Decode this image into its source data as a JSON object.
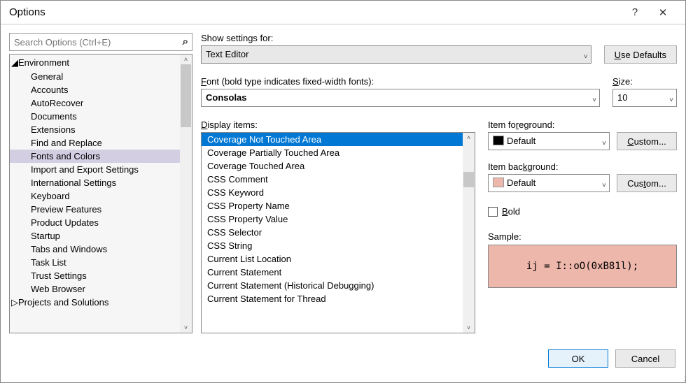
{
  "window": {
    "title": "Options",
    "help": "?",
    "close": "✕"
  },
  "search": {
    "placeholder": "Search Options (Ctrl+E)"
  },
  "tree": {
    "items": [
      {
        "label": "Environment",
        "lvl": 0,
        "caret": "◢"
      },
      {
        "label": "General",
        "lvl": 1
      },
      {
        "label": "Accounts",
        "lvl": 1
      },
      {
        "label": "AutoRecover",
        "lvl": 1
      },
      {
        "label": "Documents",
        "lvl": 1
      },
      {
        "label": "Extensions",
        "lvl": 1
      },
      {
        "label": "Find and Replace",
        "lvl": 1
      },
      {
        "label": "Fonts and Colors",
        "lvl": 1,
        "selected": true
      },
      {
        "label": "Import and Export Settings",
        "lvl": 1
      },
      {
        "label": "International Settings",
        "lvl": 1
      },
      {
        "label": "Keyboard",
        "lvl": 1
      },
      {
        "label": "Preview Features",
        "lvl": 1
      },
      {
        "label": "Product Updates",
        "lvl": 1
      },
      {
        "label": "Startup",
        "lvl": 1
      },
      {
        "label": "Tabs and Windows",
        "lvl": 1
      },
      {
        "label": "Task List",
        "lvl": 1
      },
      {
        "label": "Trust Settings",
        "lvl": 1
      },
      {
        "label": "Web Browser",
        "lvl": 1
      },
      {
        "label": "Projects and Solutions",
        "lvl": 0,
        "caret": "▷"
      }
    ]
  },
  "settings_for": {
    "label": "Show settings for:",
    "value": "Text Editor"
  },
  "use_defaults": "Use Defaults",
  "font": {
    "label": "Font (bold type indicates fixed-width fonts):",
    "value": "Consolas"
  },
  "size": {
    "label": "Size:",
    "value": "10"
  },
  "display_items": {
    "label": "Display items:",
    "items": [
      "Coverage Not Touched Area",
      "Coverage Partially Touched Area",
      "Coverage Touched Area",
      "CSS Comment",
      "CSS Keyword",
      "CSS Property Name",
      "CSS Property Value",
      "CSS Selector",
      "CSS String",
      "Current List Location",
      "Current Statement",
      "Current Statement (Historical Debugging)",
      "Current Statement for Thread"
    ]
  },
  "foreground": {
    "label": "Item foreground:",
    "value": "Default",
    "custom": "Custom..."
  },
  "background": {
    "label": "Item background:",
    "value": "Default",
    "custom": "Custom..."
  },
  "bold": {
    "label": "Bold"
  },
  "sample": {
    "label": "Sample:",
    "text": "ij = I::oO(0xB81l);"
  },
  "footer": {
    "ok": "OK",
    "cancel": "Cancel"
  }
}
